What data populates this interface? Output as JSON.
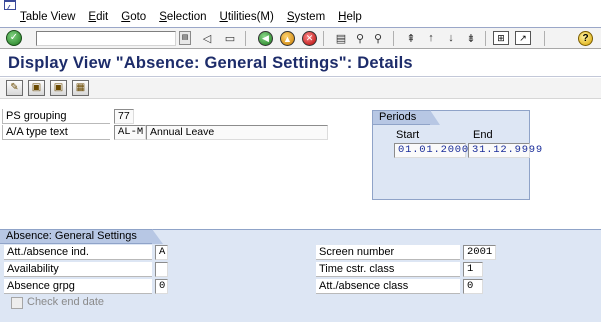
{
  "menu": {
    "items": [
      "Table View",
      "Edit",
      "Goto",
      "Selection",
      "Utilities(M)",
      "System",
      "Help"
    ]
  },
  "toolbar": {
    "command_value": "",
    "icons": [
      "enter-icon",
      "command-field",
      "save-icon",
      "back-icon",
      "exit-icon",
      "cancel-icon",
      "print-icon",
      "find-icon",
      "find-next-icon",
      "first-page-icon",
      "previous-page-icon",
      "next-page-icon",
      "last-page-icon",
      "create-session-icon",
      "shortcut-icon",
      "help-icon"
    ]
  },
  "title": "Display View \"Absence: General Settings\": Details",
  "app_toolbar": {
    "icons": [
      "display-change-icon",
      "previous-entry-icon",
      "next-entry-icon",
      "variable-list-icon"
    ]
  },
  "header_fields": {
    "ps_grouping": {
      "label": "PS grouping",
      "value": "77"
    },
    "aa_type": {
      "label": "A/A type text",
      "code": "AL-M",
      "text": "Annual Leave"
    }
  },
  "periods": {
    "title": "Periods",
    "start_label": "Start",
    "end_label": "End",
    "start": "01.01.2000",
    "end": "31.12.9999"
  },
  "general_settings": {
    "title": "Absence: General Settings",
    "left": [
      {
        "label": "Att./absence ind.",
        "value": "A"
      },
      {
        "label": "Availability",
        "value": ""
      },
      {
        "label": "Absence grpg",
        "value": "0"
      }
    ],
    "right": [
      {
        "label": "Screen number",
        "value": "2001"
      },
      {
        "label": "Time cstr. class",
        "value": "1"
      },
      {
        "label": "Att./absence class",
        "value": "0"
      }
    ],
    "check_end_date": {
      "label": "Check end date",
      "checked": false
    }
  },
  "colors": {
    "title": "#1d2c6a",
    "section_bg": "#dde6f4",
    "section_tab": "#b7c7e4",
    "date_text": "#1a2d9a"
  }
}
